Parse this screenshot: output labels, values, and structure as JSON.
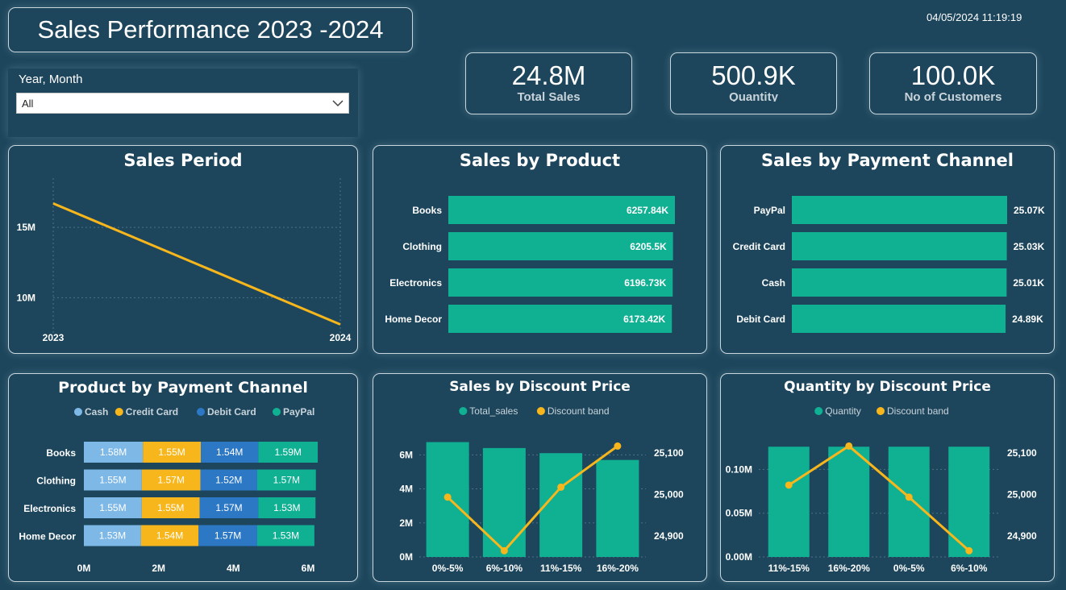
{
  "header": {
    "title": "Sales Performance 2023 -2024",
    "datetime": "04/05/2024 11:19:19"
  },
  "slicer": {
    "label": "Year, Month",
    "value": "All"
  },
  "kpis": [
    {
      "value": "24.8M",
      "label": "Total Sales"
    },
    {
      "value": "500.9K",
      "label": "Quantity"
    },
    {
      "value": "100.0K",
      "label": "No of Customers"
    }
  ],
  "colors": {
    "background": "#1d465c",
    "teal": "#10b093",
    "gold": "#f7b61c",
    "light_blue": "#7db8e6",
    "blue": "#2d78c4"
  },
  "icons": {
    "dropdown": "chevron-down-icon"
  },
  "chart_data": [
    {
      "type": "line",
      "title": "Sales Period",
      "x": [
        "2023",
        "2024"
      ],
      "values": [
        16.7,
        8.1
      ],
      "yticks": [
        "15M",
        "10M"
      ],
      "ylim": [
        7.5,
        18.5
      ],
      "value_unit": "M",
      "grid": true
    },
    {
      "type": "bar",
      "orientation": "horizontal",
      "title": "Sales by Product",
      "categories": [
        "Books",
        "Clothing",
        "Electronics",
        "Home Decor"
      ],
      "values": [
        6257.84,
        6205.5,
        6196.73,
        6173.42
      ],
      "labels": [
        "6257.84K",
        "6205.5K",
        "6196.73K",
        "6173.42K"
      ]
    },
    {
      "type": "bar",
      "orientation": "horizontal",
      "title": "Sales by Payment Channel",
      "categories": [
        "PayPal",
        "Credit Card",
        "Cash",
        "Debit Card"
      ],
      "values": [
        25.07,
        25.03,
        25.01,
        24.89
      ],
      "labels": [
        "25.07K",
        "25.03K",
        "25.01K",
        "24.89K"
      ]
    },
    {
      "type": "bar",
      "orientation": "horizontal",
      "stacked": true,
      "title": "Product by Payment Channel",
      "categories": [
        "Books",
        "Clothing",
        "Electronics",
        "Home Decor"
      ],
      "xticks": [
        "0M",
        "2M",
        "4M",
        "6M"
      ],
      "xlim": [
        0,
        6.4
      ],
      "series": [
        {
          "name": "Cash",
          "color": "#7db8e6",
          "values": [
            1.58,
            1.55,
            1.55,
            1.53
          ],
          "labels": [
            "1.58M",
            "1.55M",
            "1.55M",
            "1.53M"
          ]
        },
        {
          "name": "Credit Card",
          "color": "#f7b61c",
          "values": [
            1.55,
            1.57,
            1.55,
            1.54
          ],
          "labels": [
            "1.55M",
            "1.57M",
            "1.55M",
            "1.54M"
          ]
        },
        {
          "name": "Debit Card",
          "color": "#2d78c4",
          "values": [
            1.54,
            1.52,
            1.57,
            1.57
          ],
          "labels": [
            "1.54M",
            "1.52M",
            "1.57M",
            "1.57M"
          ]
        },
        {
          "name": "PayPal",
          "color": "#10b093",
          "values": [
            1.59,
            1.57,
            1.53,
            1.53
          ],
          "labels": [
            "1.59M",
            "1.57M",
            "1.53M",
            "1.53M"
          ]
        }
      ]
    },
    {
      "type": "bar",
      "combo": "bar+line",
      "title": "Sales by Discount Price",
      "categories": [
        "0%-5%",
        "6%-10%",
        "11%-15%",
        "16%-20%"
      ],
      "series": [
        {
          "name": "Total_sales",
          "type": "bar",
          "color": "#10b093",
          "values": [
            6.75,
            6.4,
            6.1,
            5.7
          ],
          "axis": "left"
        },
        {
          "name": "Discount band",
          "type": "line",
          "color": "#f7b61c",
          "values": [
            24994,
            24865,
            25018,
            25117
          ],
          "axis": "right"
        }
      ],
      "yticks_left": [
        "6M",
        "4M",
        "2M",
        "0M"
      ],
      "ylim_left": [
        0,
        7.2
      ],
      "yticks_right": [
        "25,100",
        "25,000",
        "24,900"
      ],
      "ylim_right": [
        24850,
        25145
      ]
    },
    {
      "type": "bar",
      "combo": "bar+line",
      "title": "Quantity by Discount Price",
      "categories": [
        "11%-15%",
        "16%-20%",
        "0%-5%",
        "6%-10%"
      ],
      "series": [
        {
          "name": "Quantity",
          "type": "bar",
          "color": "#10b093",
          "values": [
            0.126,
            0.126,
            0.126,
            0.126
          ],
          "axis": "left"
        },
        {
          "name": "Discount band",
          "type": "line",
          "color": "#f7b61c",
          "values": [
            25023,
            25117,
            24994,
            24865
          ],
          "axis": "right"
        }
      ],
      "yticks_left": [
        "0.10M",
        "0.05M",
        "0.00M"
      ],
      "ylim_left": [
        0,
        0.14
      ],
      "yticks_right": [
        "25,100",
        "25,000",
        "24,900"
      ],
      "ylim_right": [
        24850,
        25145
      ]
    }
  ]
}
